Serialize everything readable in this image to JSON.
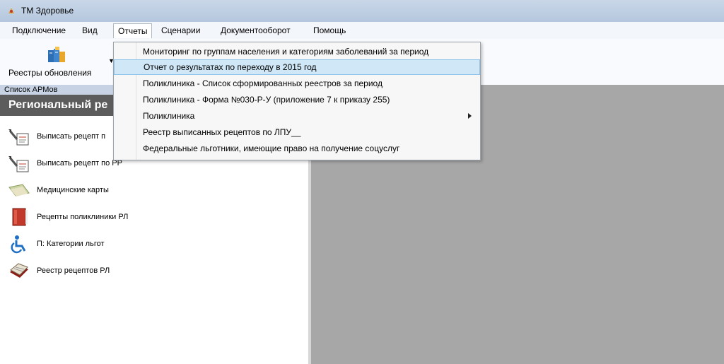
{
  "window": {
    "title": "ТМ Здоровье"
  },
  "menubar": {
    "items": [
      {
        "label": "Подключение"
      },
      {
        "label": "Вид"
      },
      {
        "label": "Отчеты"
      },
      {
        "label": "Сценарии"
      },
      {
        "label": "Документооборот"
      },
      {
        "label": "Помощь"
      }
    ]
  },
  "toolbar": {
    "registry_button_label": "Реестры обновления"
  },
  "left_pane": {
    "header": "Список АРМов",
    "region_title": "Региональный ре",
    "items": [
      {
        "label": "Выписать рецепт п",
        "icon": "prescription-pen-icon"
      },
      {
        "label": "Выписать рецепт по РР",
        "icon": "prescription-pen-icon"
      },
      {
        "label": "Медицинские карты",
        "icon": "medical-card-icon"
      },
      {
        "label": "Рецепты поликлиники РЛ",
        "icon": "red-book-icon"
      },
      {
        "label": "П: Категории льгот",
        "icon": "wheelchair-icon"
      },
      {
        "label": "Реестр рецептов РЛ",
        "icon": "card-stack-icon"
      }
    ]
  },
  "reports_menu": {
    "items": [
      {
        "label": "Мониторинг по группам населения и категориям заболеваний за период"
      },
      {
        "label": "Отчет о  результатах по переходу в 2015 год"
      },
      {
        "label": "Поликлиника - Список сформированных реестров за период"
      },
      {
        "label": "Поликлиника - Форма №030-Р-У (приложение 7 к приказу 255)"
      },
      {
        "label": "Поликлиника"
      },
      {
        "label": "Реестр выписанных рецептов по ЛПУ__"
      },
      {
        "label": "Федеральные льготники, имеющие право на получение соцуслуг"
      }
    ]
  },
  "colors": {
    "content_bg": "#a7a7a7",
    "region_bar": "#5c5c5c",
    "highlight": "#cfe7f7"
  }
}
